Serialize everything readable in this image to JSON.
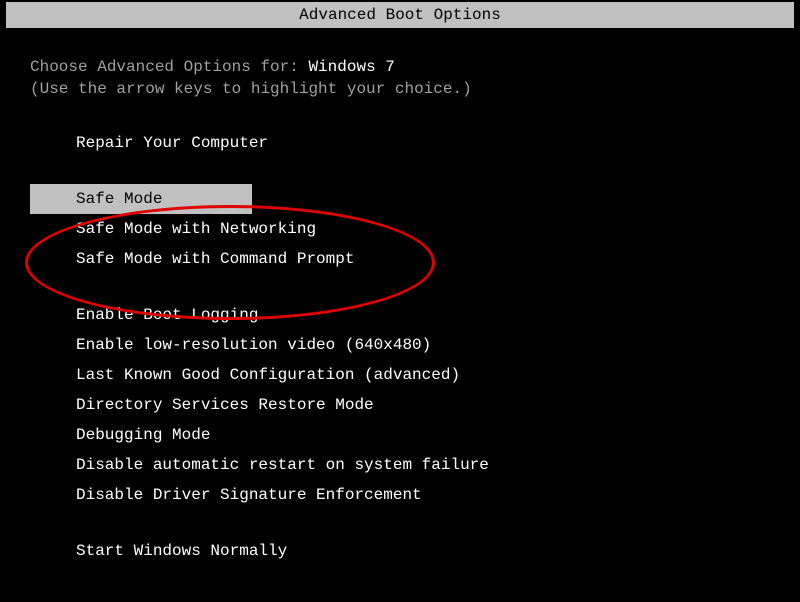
{
  "title": "Advanced Boot Options",
  "prompt_prefix": "Choose Advanced Options for: ",
  "os_name": "Windows 7",
  "instruction": "(Use the arrow keys to highlight your choice.)",
  "groups": [
    {
      "items": [
        {
          "label": "Repair Your Computer",
          "selected": false
        }
      ]
    },
    {
      "items": [
        {
          "label": "Safe Mode",
          "selected": true
        },
        {
          "label": "Safe Mode with Networking",
          "selected": false
        },
        {
          "label": "Safe Mode with Command Prompt",
          "selected": false
        }
      ]
    },
    {
      "items": [
        {
          "label": "Enable Boot Logging",
          "selected": false
        },
        {
          "label": "Enable low-resolution video (640x480)",
          "selected": false
        },
        {
          "label": "Last Known Good Configuration (advanced)",
          "selected": false
        },
        {
          "label": "Directory Services Restore Mode",
          "selected": false
        },
        {
          "label": "Debugging Mode",
          "selected": false
        },
        {
          "label": "Disable automatic restart on system failure",
          "selected": false
        },
        {
          "label": "Disable Driver Signature Enforcement",
          "selected": false
        }
      ]
    },
    {
      "items": [
        {
          "label": "Start Windows Normally",
          "selected": false
        }
      ]
    }
  ],
  "annotation": {
    "shape": "ellipse",
    "color": "#e00000"
  }
}
